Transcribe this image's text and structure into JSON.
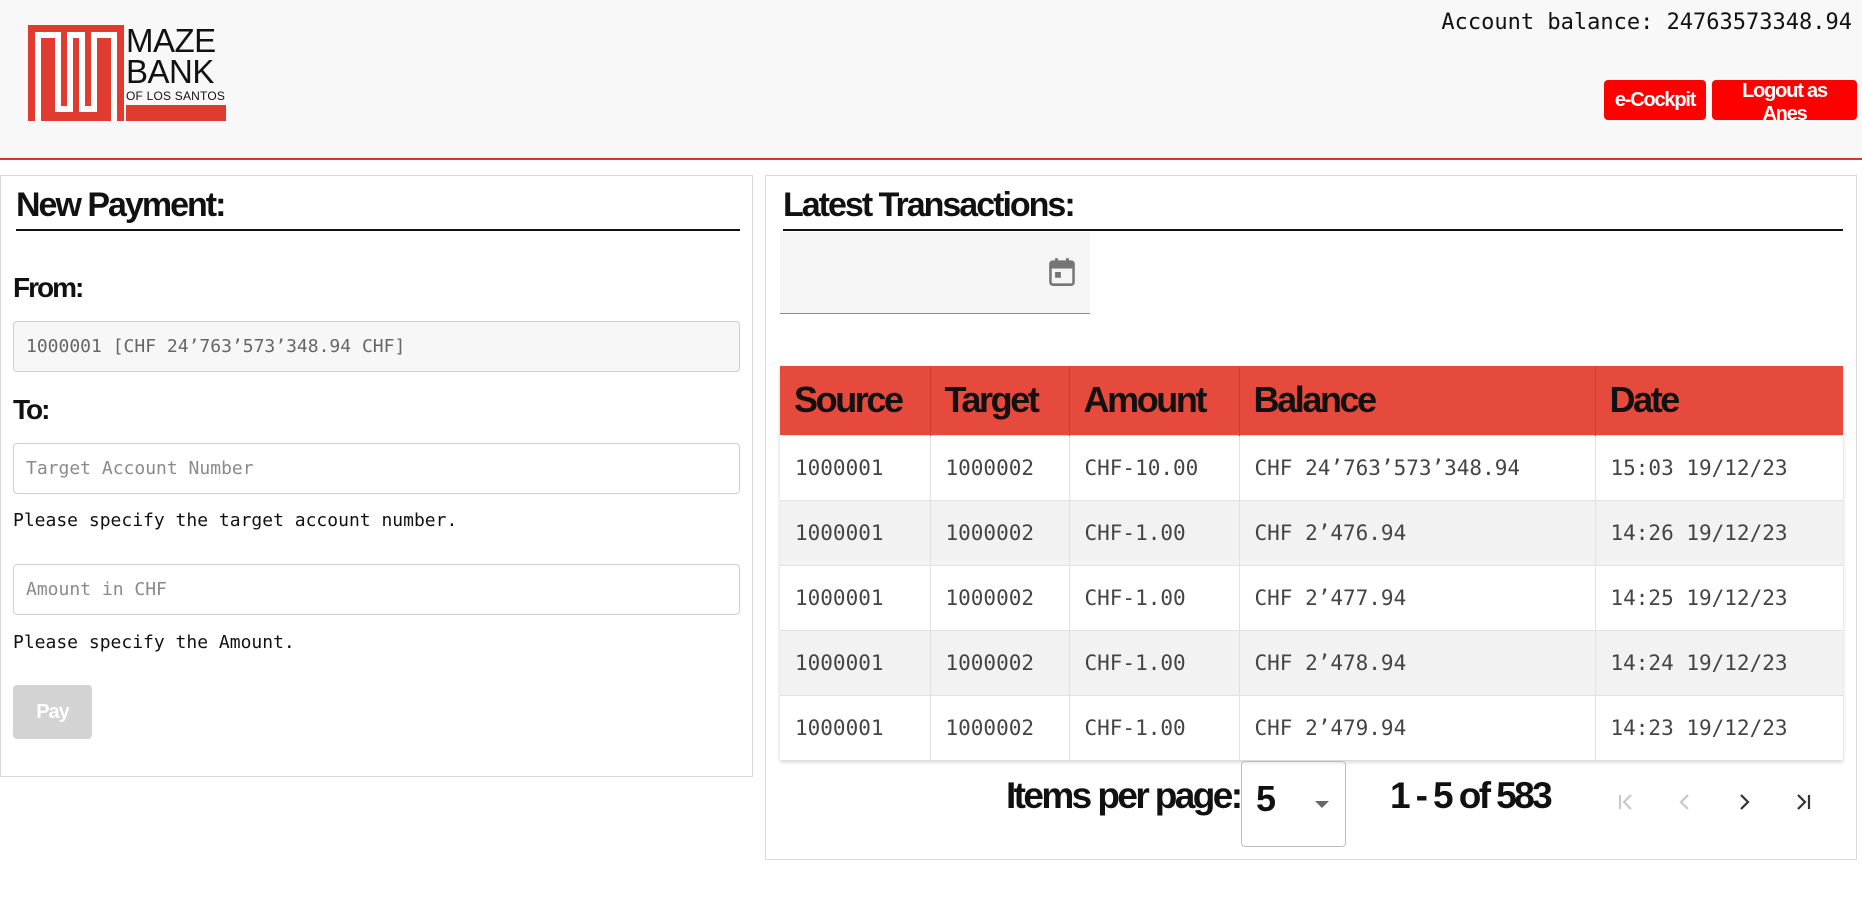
{
  "header": {
    "logo": {
      "line1": "MAZE",
      "line2": "BANK",
      "line3": "OF LOS SANTOS"
    },
    "balance_label": "Account balance:",
    "balance_value": "24763573348.94",
    "cockpit_label": "e-Cockpit",
    "logout_label": "Logout as Anes"
  },
  "payment": {
    "title": "New Payment:",
    "from_label": "From:",
    "from_value": "1000001 [CHF 24’763’573’348.94 CHF]",
    "to_label": "To:",
    "target_placeholder": "Target Account Number",
    "target_hint": "Please specify the target account number.",
    "amount_placeholder": "Amount in CHF",
    "amount_hint": "Please specify the Amount.",
    "pay_label": "Pay"
  },
  "transactions": {
    "title": "Latest Transactions:",
    "date_icon": "calendar-icon",
    "columns": [
      "Source",
      "Target",
      "Amount",
      "Balance",
      "Date"
    ],
    "rows": [
      [
        "1000001",
        "1000002",
        "CHF-10.00",
        "CHF 24’763’573’348.94",
        "15:03 19/12/23"
      ],
      [
        "1000001",
        "1000002",
        "CHF-1.00",
        "CHF 2’476.94",
        "14:26 19/12/23"
      ],
      [
        "1000001",
        "1000002",
        "CHF-1.00",
        "CHF 2’477.94",
        "14:25 19/12/23"
      ],
      [
        "1000001",
        "1000002",
        "CHF-1.00",
        "CHF 2’478.94",
        "14:24 19/12/23"
      ],
      [
        "1000001",
        "1000002",
        "CHF-1.00",
        "CHF 2’479.94",
        "14:23 19/12/23"
      ]
    ]
  },
  "paginator": {
    "items_per_page_label": "Items per page:",
    "items_per_page_value": "5",
    "range_label": "1 - 5 of 583",
    "icons": [
      "first-page-icon",
      "previous-page-icon",
      "next-page-icon",
      "last-page-icon"
    ]
  },
  "colors": {
    "brand_red": "#e13a31",
    "button_red": "#ff0000",
    "table_header": "#e64a3c",
    "disabled": "#d3d3d3"
  }
}
